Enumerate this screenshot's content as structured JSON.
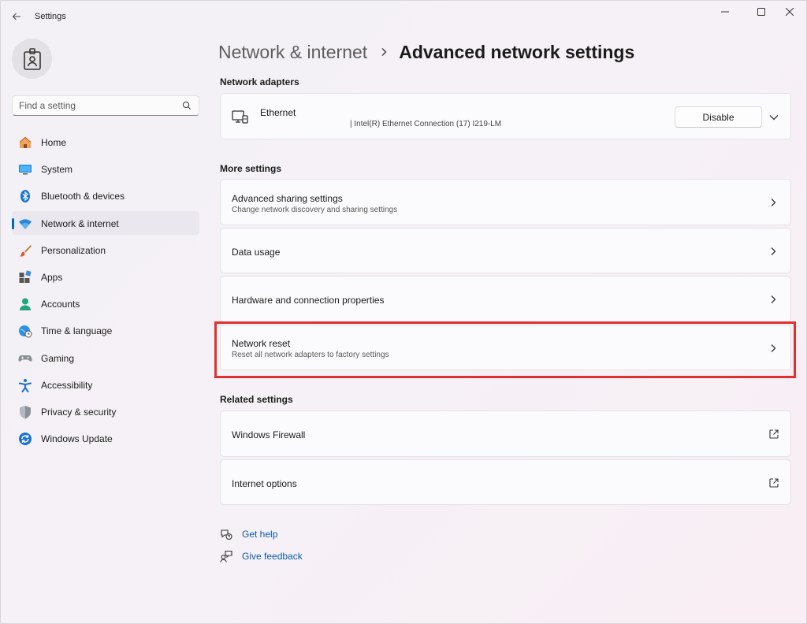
{
  "window": {
    "app_title": "Settings"
  },
  "sidebar": {
    "search_placeholder": "Find a setting",
    "items": [
      {
        "label": "Home",
        "icon": "home-icon",
        "active": false
      },
      {
        "label": "System",
        "icon": "system-icon",
        "active": false
      },
      {
        "label": "Bluetooth & devices",
        "icon": "bluetooth-icon",
        "active": false
      },
      {
        "label": "Network & internet",
        "icon": "wifi-icon",
        "active": true
      },
      {
        "label": "Personalization",
        "icon": "brush-icon",
        "active": false
      },
      {
        "label": "Apps",
        "icon": "apps-icon",
        "active": false
      },
      {
        "label": "Accounts",
        "icon": "account-icon",
        "active": false
      },
      {
        "label": "Time & language",
        "icon": "globe-clock-icon",
        "active": false
      },
      {
        "label": "Gaming",
        "icon": "gamepad-icon",
        "active": false
      },
      {
        "label": "Accessibility",
        "icon": "accessibility-icon",
        "active": false
      },
      {
        "label": "Privacy & security",
        "icon": "shield-icon",
        "active": false
      },
      {
        "label": "Windows Update",
        "icon": "update-icon",
        "active": false
      }
    ]
  },
  "header": {
    "parent": "Network & internet",
    "current": "Advanced network settings"
  },
  "adapters": {
    "title": "Network adapters",
    "ethernet": {
      "name": "Ethernet",
      "description": "| Intel(R) Ethernet Connection (17) I219-LM",
      "disable_label": "Disable"
    }
  },
  "more_settings": {
    "title": "More settings",
    "items": [
      {
        "title": "Advanced sharing settings",
        "subtitle": "Change network discovery and sharing settings"
      },
      {
        "title": "Data usage",
        "subtitle": ""
      },
      {
        "title": "Hardware and connection properties",
        "subtitle": ""
      },
      {
        "title": "Network reset",
        "subtitle": "Reset all network adapters to factory settings"
      }
    ]
  },
  "related_settings": {
    "title": "Related settings",
    "items": [
      {
        "title": "Windows Firewall"
      },
      {
        "title": "Internet options"
      }
    ]
  },
  "help": {
    "get_help": "Get help",
    "give_feedback": "Give feedback"
  },
  "colors": {
    "accent": "#0067c0",
    "highlight": "#e03131",
    "link": "#0a5aad"
  }
}
